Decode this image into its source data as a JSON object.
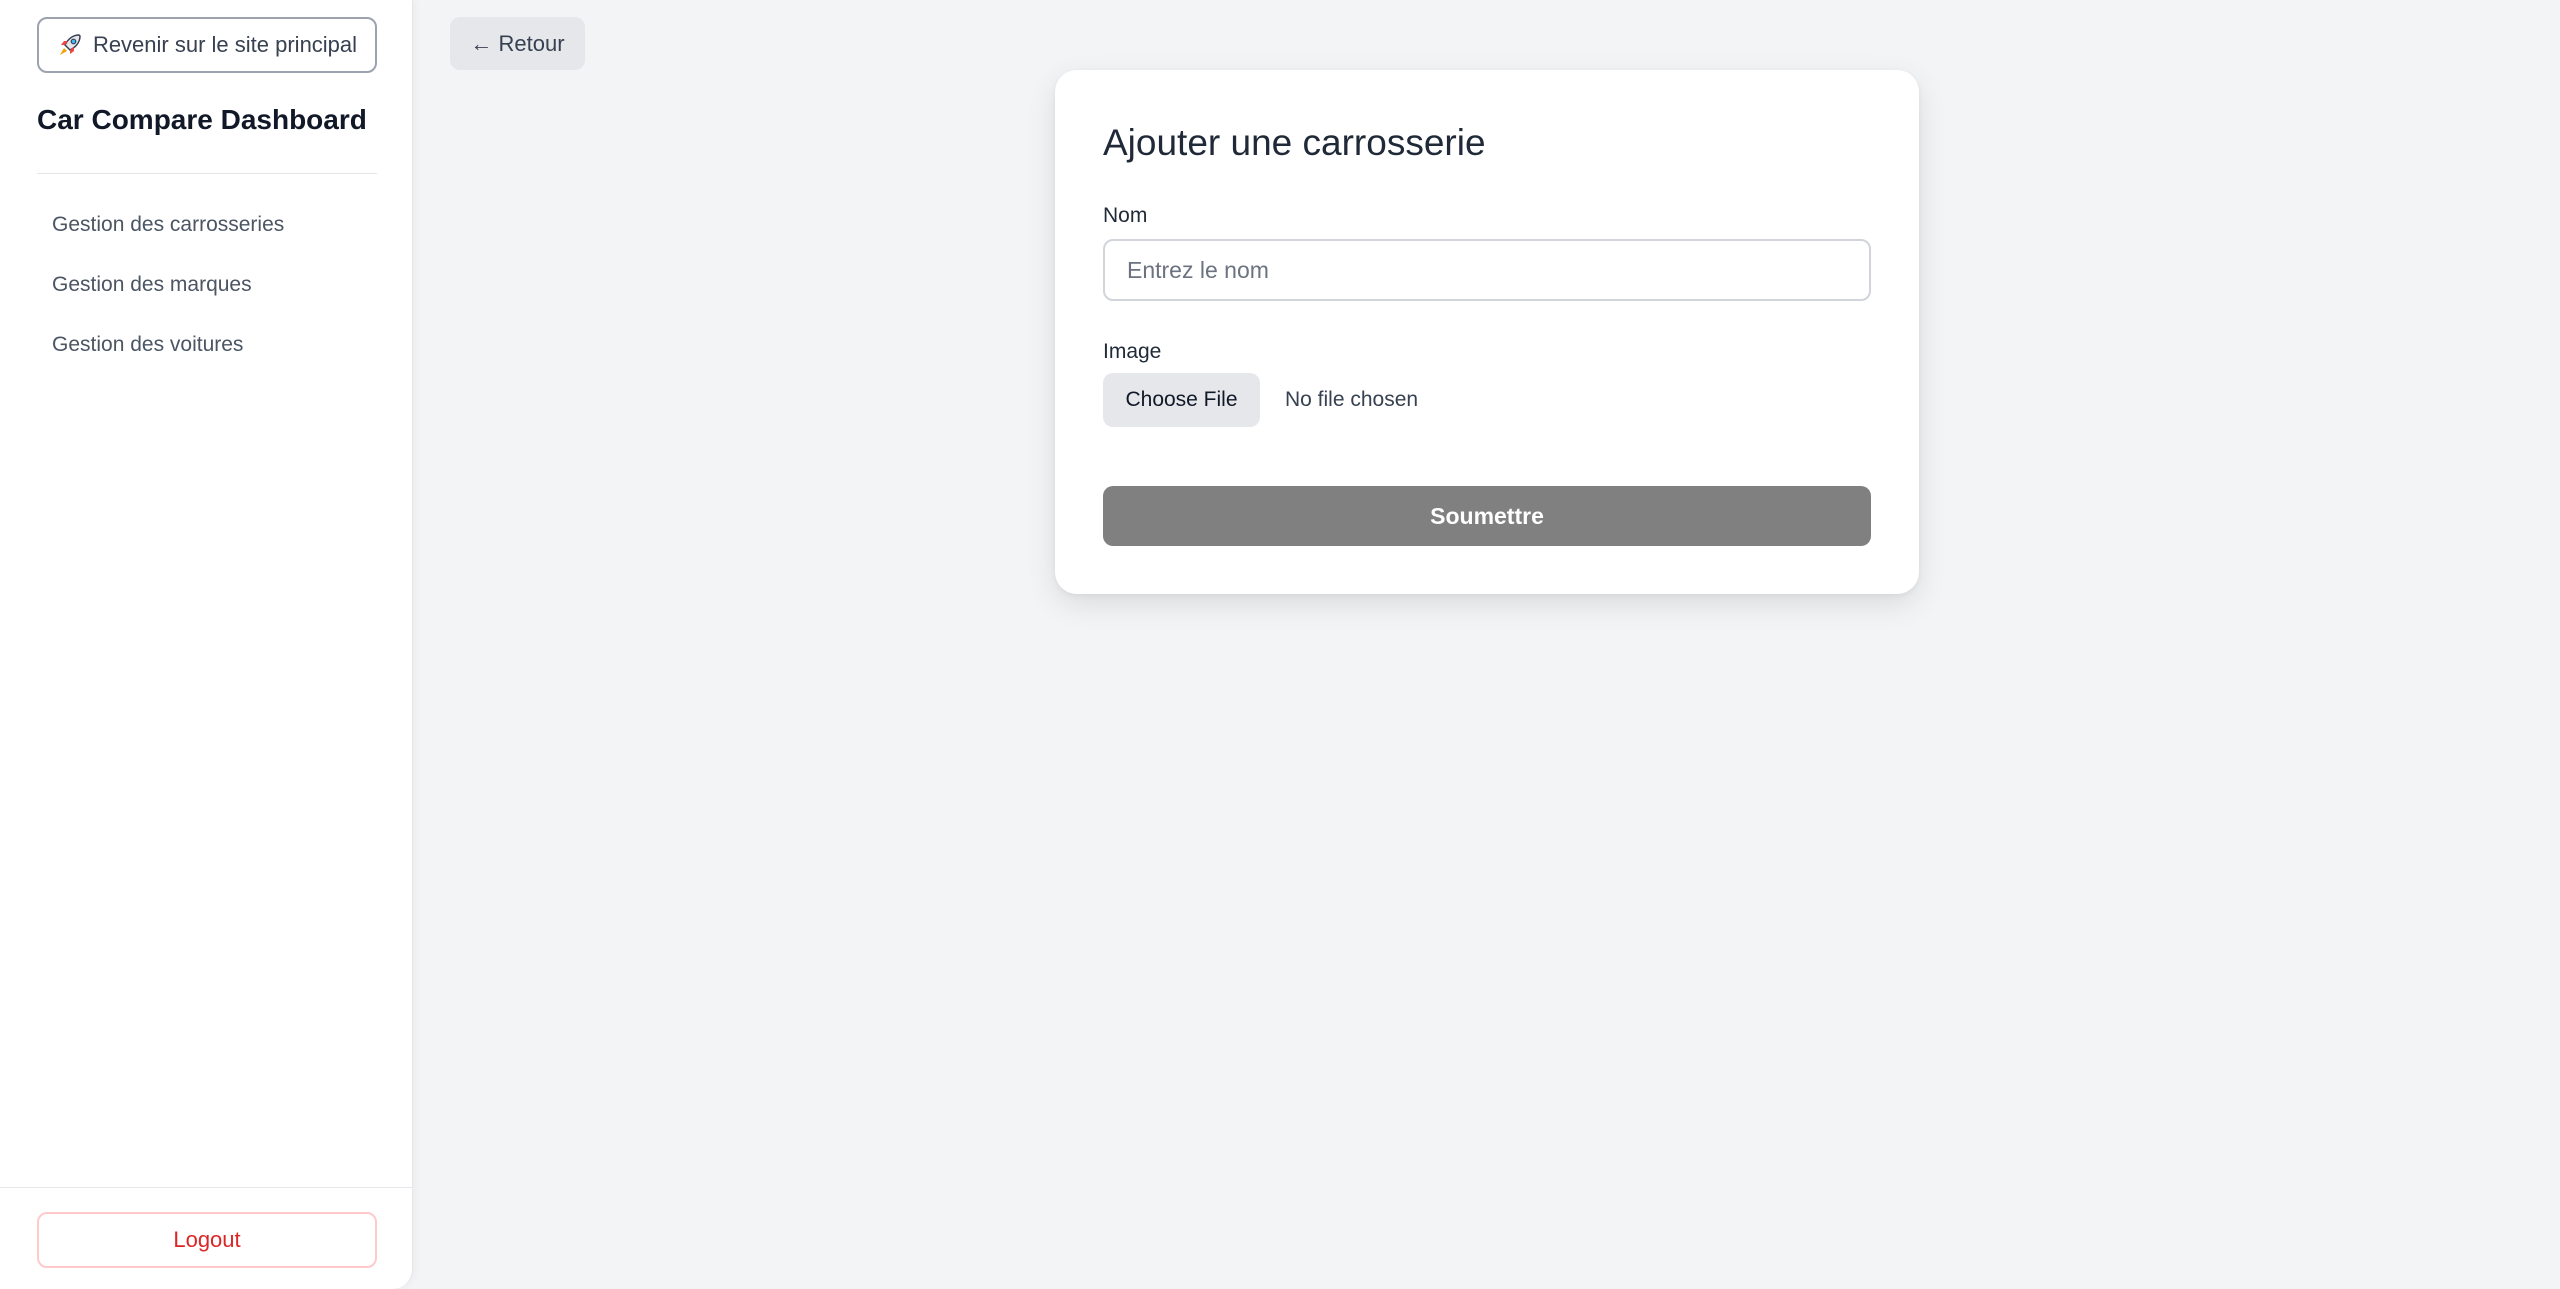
{
  "sidebar": {
    "main_site_button": {
      "icon": "rocket-icon",
      "label": "Revenir sur le site principal"
    },
    "title": "Car Compare Dashboard",
    "nav_items": [
      {
        "label": "Gestion des carrosseries"
      },
      {
        "label": "Gestion des marques"
      },
      {
        "label": "Gestion des voitures"
      }
    ],
    "logout_label": "Logout"
  },
  "back_button": {
    "label": "← Retour"
  },
  "form": {
    "title": "Ajouter une carrosserie",
    "name_label": "Nom",
    "name_value": "",
    "name_placeholder": "Entrez le nom",
    "image_label": "Image",
    "choose_file_label": "Choose File",
    "file_status": "No file chosen",
    "submit_label": "Soumettre"
  },
  "colors": {
    "background": "#f3f4f6",
    "logout_text": "#dc2626",
    "submit_button": "#808080"
  }
}
